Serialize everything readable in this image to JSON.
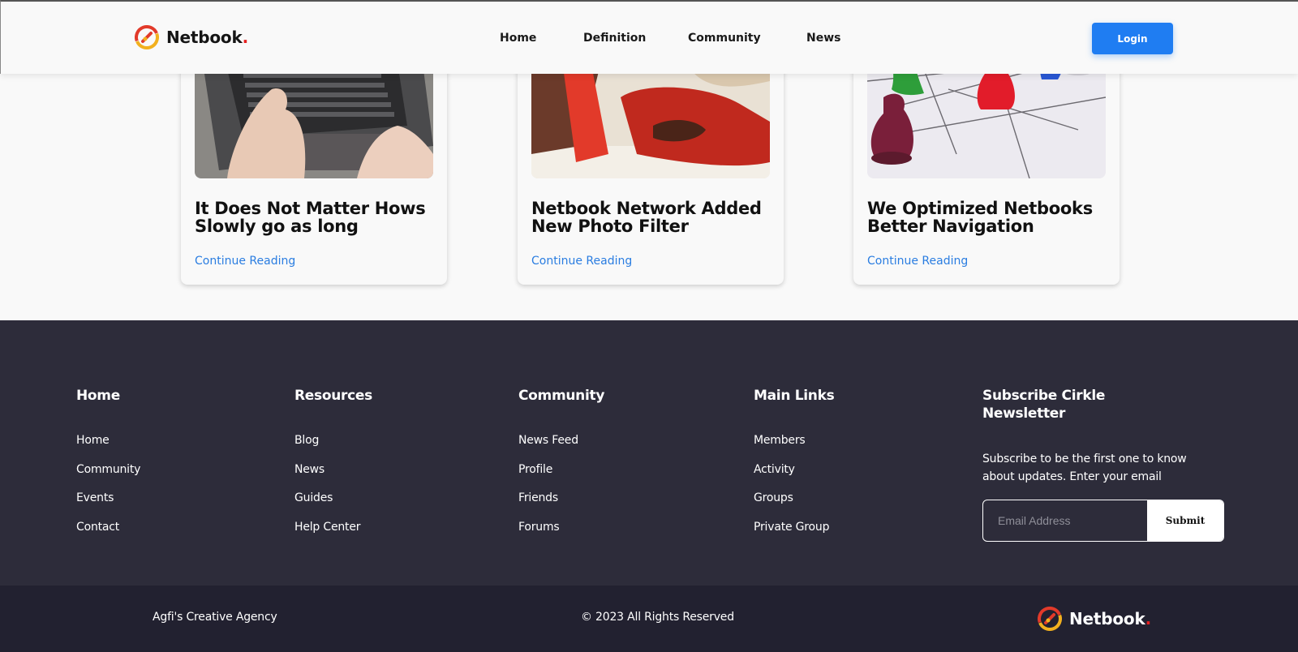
{
  "header": {
    "brand": "Netbook",
    "brand_dot": ".",
    "nav": [
      "Home",
      "Definition",
      "Community",
      "News"
    ],
    "login_label": "Login"
  },
  "posts": [
    {
      "title": "It Does Not Matter Hows Slowly go as long",
      "link": "Continue Reading",
      "image_icon": "laptop-typing-photo"
    },
    {
      "title": "Netbook Network Added New Photo Filter",
      "link": "Continue Reading",
      "image_icon": "child-playing-photo"
    },
    {
      "title": "We Optimized Netbooks Better Navigation",
      "link": "Continue Reading",
      "image_icon": "network-pawns-photo"
    }
  ],
  "footer": {
    "columns": [
      {
        "title": "Home",
        "items": [
          "Home",
          "Community",
          "Events",
          "Contact"
        ]
      },
      {
        "title": "Resources",
        "items": [
          "Blog",
          "News",
          "Guides",
          "Help Center"
        ]
      },
      {
        "title": "Community",
        "items": [
          "News Feed",
          "Profile",
          "Friends",
          "Forums"
        ]
      },
      {
        "title": "Main Links",
        "items": [
          "Members",
          "Activity",
          "Groups",
          "Private Group"
        ]
      }
    ],
    "subscribe": {
      "title": "Subscribe Cirkle Newsletter",
      "description": "Subscribe to be the first one to know about updates. Enter your email",
      "placeholder": "Email Address",
      "button": "Submit"
    }
  },
  "bottom_bar": {
    "agency": "Agfi's Creative Agency",
    "copyright": "© 2023 All Rights Reserved",
    "brand": "Netbook",
    "brand_dot": "."
  },
  "colors": {
    "accent": "#1f7df2",
    "link": "#2a7de1",
    "footer_bg": "#2d2c3a",
    "bottom_bg": "#222130",
    "logo_dot": "#e62020"
  }
}
